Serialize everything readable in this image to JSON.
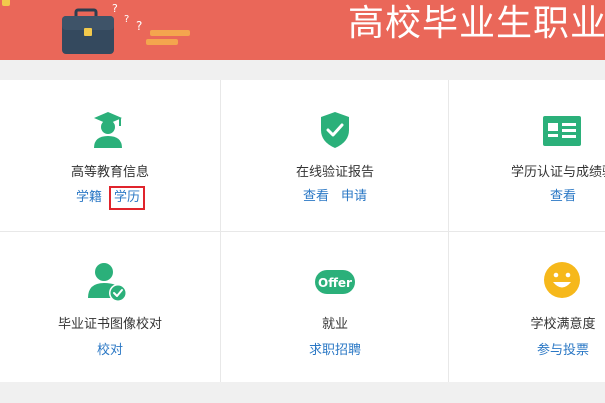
{
  "banner": {
    "title": "高校毕业生职业",
    "question_marks": "? ? ?",
    "bg_color": "#ea6759"
  },
  "grid": {
    "rows": [
      [
        {
          "icon": "graduate-icon",
          "title": "高等教育信息",
          "links": [
            "学籍",
            "学历"
          ],
          "highlighted_link": 1
        },
        {
          "icon": "shield-check-icon",
          "title": "在线验证报告",
          "links": [
            "查看",
            "申请"
          ]
        },
        {
          "icon": "certificate-card-icon",
          "title": "学历认证与成绩验",
          "links": [
            "查看"
          ]
        }
      ],
      [
        {
          "icon": "user-check-icon",
          "title": "毕业证书图像校对",
          "links": [
            "校对"
          ]
        },
        {
          "icon": "offer-badge-icon",
          "title": "就业",
          "links": [
            "求职招聘"
          ],
          "badge_text": "Offer"
        },
        {
          "icon": "smiley-face-icon",
          "title": "学校满意度",
          "links": [
            "参与投票"
          ]
        }
      ]
    ]
  },
  "colors": {
    "green": "#2bb07a",
    "link": "#2b78c5",
    "highlight": "#e0242c",
    "smiley": "#f6b81b"
  }
}
